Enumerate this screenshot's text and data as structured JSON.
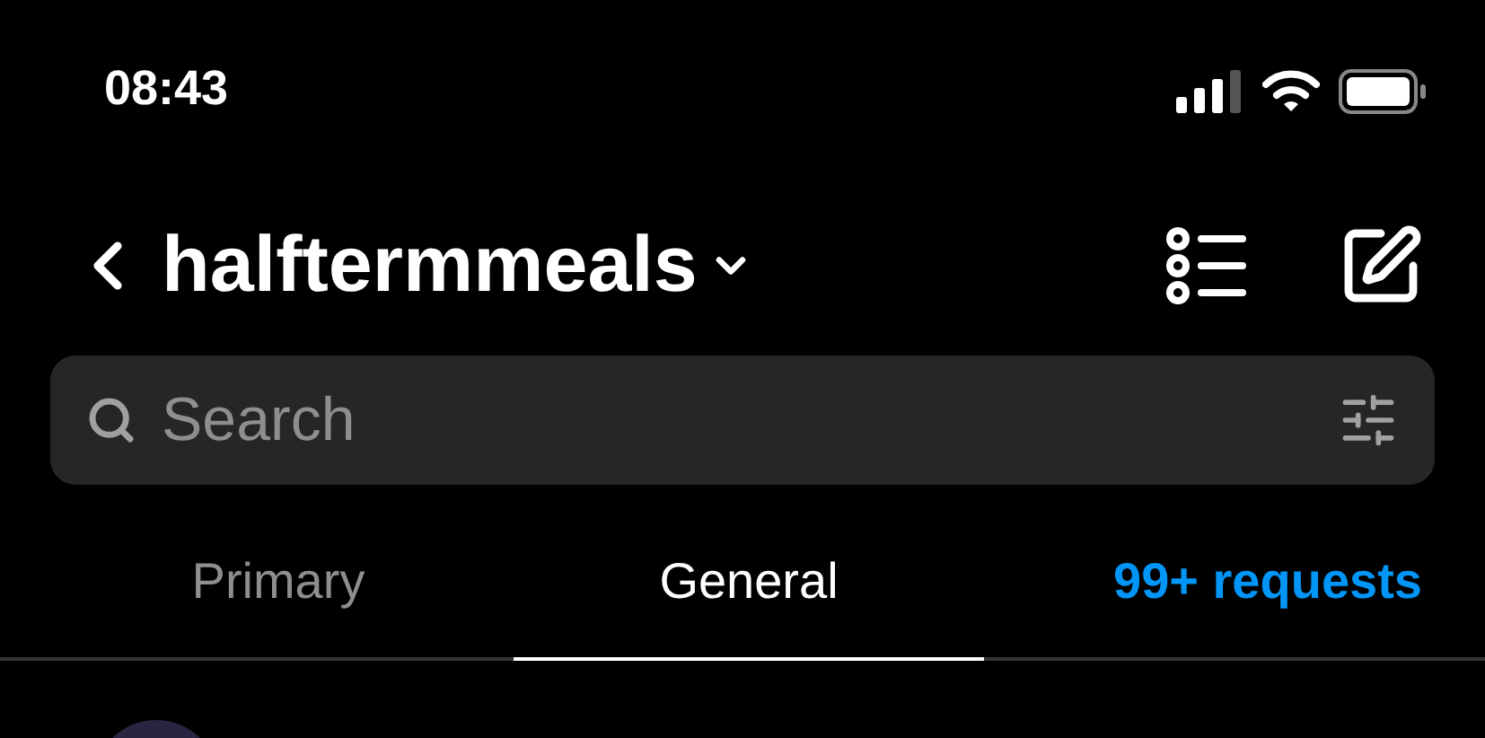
{
  "status_bar": {
    "time": "08:43"
  },
  "header": {
    "title": "halftermmeals"
  },
  "search": {
    "placeholder": "Search"
  },
  "tabs": [
    {
      "label": "Primary",
      "kind": "tab",
      "selected": false
    },
    {
      "label": "General",
      "kind": "tab",
      "selected": true
    },
    {
      "label": "99+ requests",
      "kind": "link",
      "selected": false
    }
  ]
}
